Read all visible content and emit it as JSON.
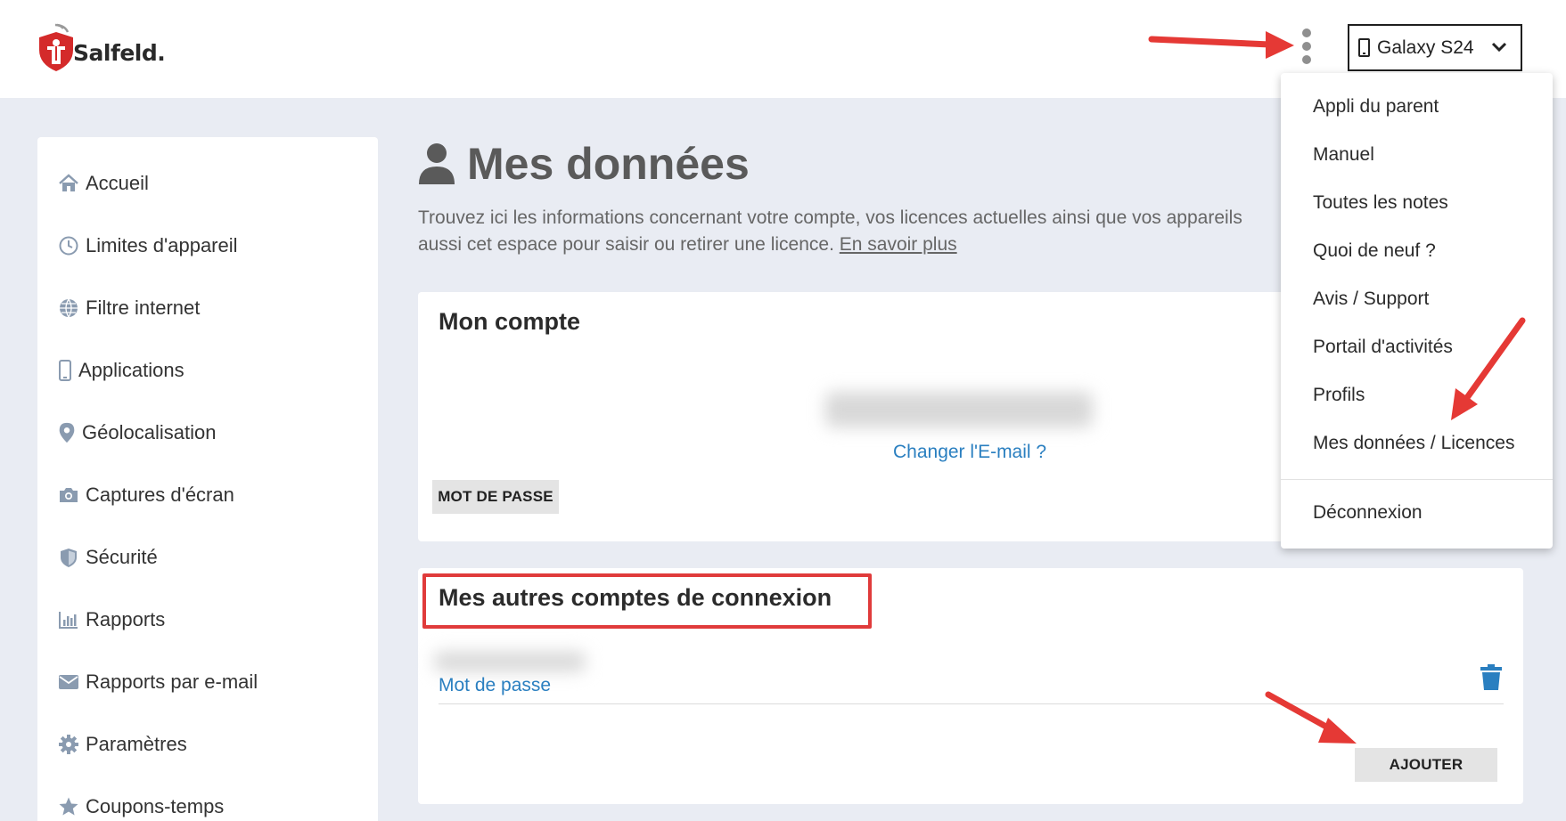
{
  "app": {
    "brand_name": "Salfeld."
  },
  "header": {
    "device_selector": {
      "selected": "Galaxy S24"
    }
  },
  "menu": {
    "items": [
      {
        "label": "Appli du parent"
      },
      {
        "label": "Manuel"
      },
      {
        "label": "Toutes les notes"
      },
      {
        "label": "Quoi de neuf ?"
      },
      {
        "label": "Avis / Support"
      },
      {
        "label": "Portail d'activités"
      },
      {
        "label": "Profils"
      },
      {
        "label": "Mes données / Licences"
      }
    ],
    "logout": "Déconnexion"
  },
  "sidebar": {
    "items": [
      {
        "label": "Accueil",
        "icon": "home-icon"
      },
      {
        "label": "Limites d'appareil",
        "icon": "clock-icon"
      },
      {
        "label": "Filtre internet",
        "icon": "globe-icon"
      },
      {
        "label": "Applications",
        "icon": "mobile-icon"
      },
      {
        "label": "Géolocalisation",
        "icon": "map-pin-icon"
      },
      {
        "label": "Captures d'écran",
        "icon": "camera-icon"
      },
      {
        "label": "Sécurité",
        "icon": "shield-icon"
      },
      {
        "label": "Rapports",
        "icon": "bar-chart-icon"
      },
      {
        "label": "Rapports par e-mail",
        "icon": "envelope-icon"
      },
      {
        "label": "Paramètres",
        "icon": "gear-icon"
      },
      {
        "label": "Coupons-temps",
        "icon": "star-icon"
      }
    ]
  },
  "main": {
    "title": "Mes données",
    "intro_line1": "Trouvez ici les informations concernant votre compte, vos licences actuelles ainsi que vos appareils",
    "intro_line2": "aussi cet espace pour saisir ou retirer une licence.",
    "intro_link": "En savoir plus",
    "account_card": {
      "title": "Mon compte",
      "change_email_link": "Changer l'E-mail ?",
      "password_button": "MOT DE PASSE"
    },
    "other_accounts_card": {
      "title": "Mes autres comptes de connexion",
      "password_link": "Mot de passe",
      "add_button": "AJOUTER"
    }
  },
  "colors": {
    "accent_blue": "#2a7fc0",
    "annotation_red": "#e03b3b",
    "page_background": "#e9ecf3"
  }
}
